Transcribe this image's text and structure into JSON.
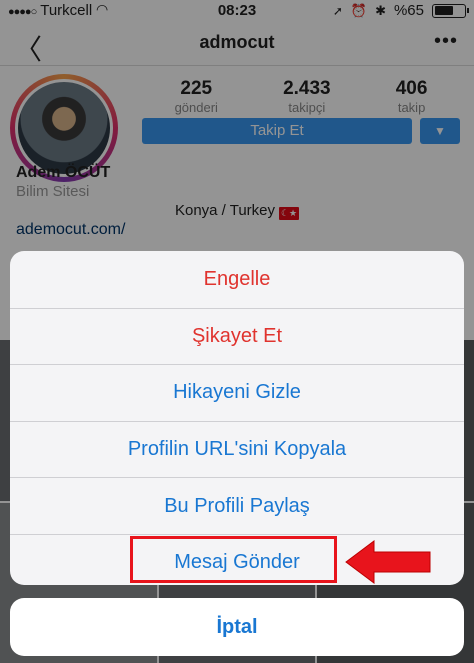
{
  "status_bar": {
    "carrier": "Turkcell",
    "time": "08:23",
    "battery": "%65",
    "battery_level": 0.65
  },
  "nav": {
    "title": "admocut"
  },
  "profile": {
    "stats": [
      {
        "value": "225",
        "label": "gönderi"
      },
      {
        "value": "2.433",
        "label": "takipçi"
      },
      {
        "value": "406",
        "label": "takip"
      }
    ],
    "follow_label": "Takip Et",
    "name": "Adem ÖCÜT",
    "category": "Bilim Sitesi",
    "location": "Konya / Turkey",
    "link": "ademocut.com/"
  },
  "action_sheet": {
    "items": [
      {
        "label": "Engelle",
        "style": "destructive"
      },
      {
        "label": "Şikayet Et",
        "style": "destructive"
      },
      {
        "label": "Hikayeni Gizle",
        "style": "default"
      },
      {
        "label": "Profilin URL'sini Kopyala",
        "style": "default"
      },
      {
        "label": "Bu Profili Paylaş",
        "style": "default"
      },
      {
        "label": "Mesaj Gönder",
        "style": "default"
      }
    ],
    "cancel_label": "İptal"
  },
  "colors": {
    "accent_blue": "#3897f0",
    "destructive_red": "#e0332e",
    "sheet_link_blue": "#1977d2",
    "annotation_red": "#e8141c"
  }
}
